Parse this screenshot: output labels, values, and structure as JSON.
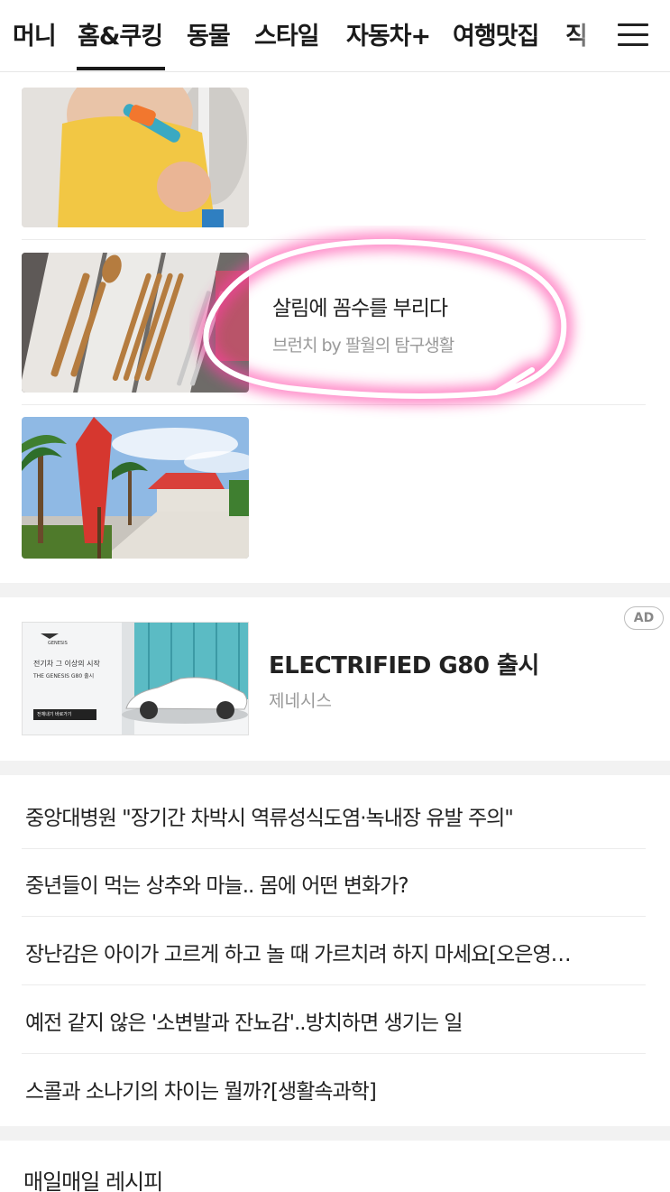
{
  "nav": {
    "tabs": [
      {
        "label": "머니"
      },
      {
        "label": "홈&쿠킹"
      },
      {
        "label": "동물"
      },
      {
        "label": "스타일"
      },
      {
        "label": "자동차+"
      },
      {
        "label": "여행맛집"
      },
      {
        "label": "직"
      }
    ],
    "active_tab": "홈&쿠킹",
    "menu_icon": "hamburger-icon"
  },
  "articles": [
    {
      "title": "",
      "source": "",
      "thumb": "baby-with-spoon"
    },
    {
      "title": "살림에 꼼수를 부리다",
      "source": "브런치 by 팔월의 탐구생활",
      "thumb": "cutlery-drawer",
      "highlighted": true
    },
    {
      "title": "",
      "source": "",
      "thumb": "palm-trees-umbrella"
    }
  ],
  "ad": {
    "badge": "AD",
    "title": "ELECTRIFIED G80 출시",
    "sponsor": "제네시스",
    "thumb_text": {
      "brand": "GENESIS",
      "line1": "전기차 그 이상의 시작",
      "line2": "THE GENESIS G80 출시",
      "cta": "전체내기 바로가기"
    }
  },
  "headlines": [
    "중앙대병원 \"장기간 차박시 역류성식도염·녹내장 유발 주의\"",
    "중년들이 먹는 상추와 마늘.. 몸에 어떤 변화가?",
    "장난감은 아이가 고르게 하고 놀 때 가르치려 하지 마세요[오은영…",
    "예전 같지 않은 '소변발과 잔뇨감'..방치하면 생기는 일",
    "스콜과 소나기의 차이는 뭘까?[생활속과학]"
  ],
  "next_section": {
    "title": "매일매일 레시피"
  },
  "colors": {
    "highlight": "#ff3fa4",
    "separator": "#f2f2f2",
    "text": "#222222",
    "muted": "#9a9a9a"
  }
}
